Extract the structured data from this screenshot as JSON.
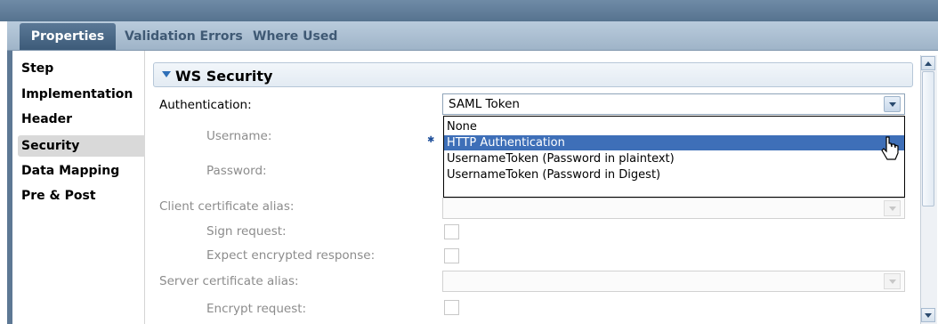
{
  "tabs": {
    "active": "Properties",
    "validation": "Validation Errors",
    "where_used": "Where Used"
  },
  "nav": {
    "items": [
      {
        "label": "Step"
      },
      {
        "label": "Implementation"
      },
      {
        "label": "Header"
      },
      {
        "label": "Security",
        "selected": true
      },
      {
        "label": "Data Mapping"
      },
      {
        "label": "Pre & Post"
      }
    ]
  },
  "section": {
    "title": "WS Security"
  },
  "form": {
    "authentication_label": "Authentication:",
    "authentication_value": "SAML Token",
    "username_label": "Username:",
    "password_label": "Password:",
    "client_cert_label": "Client certificate alias:",
    "sign_request_label": "Sign request:",
    "expect_encrypted_label": "Expect encrypted response:",
    "server_cert_label": "Server certificate alias:",
    "encrypt_request_label": "Encrypt request:"
  },
  "dropdown": {
    "options": [
      {
        "label": "None"
      },
      {
        "label": "HTTP Authentication",
        "highlighted": true
      },
      {
        "label": "UsernameToken (Password in plaintext)"
      },
      {
        "label": "UsernameToken (Password in Digest)"
      }
    ]
  },
  "colors": {
    "accent": "#3e6fb8",
    "tab_active_bg": "#4a6886"
  }
}
